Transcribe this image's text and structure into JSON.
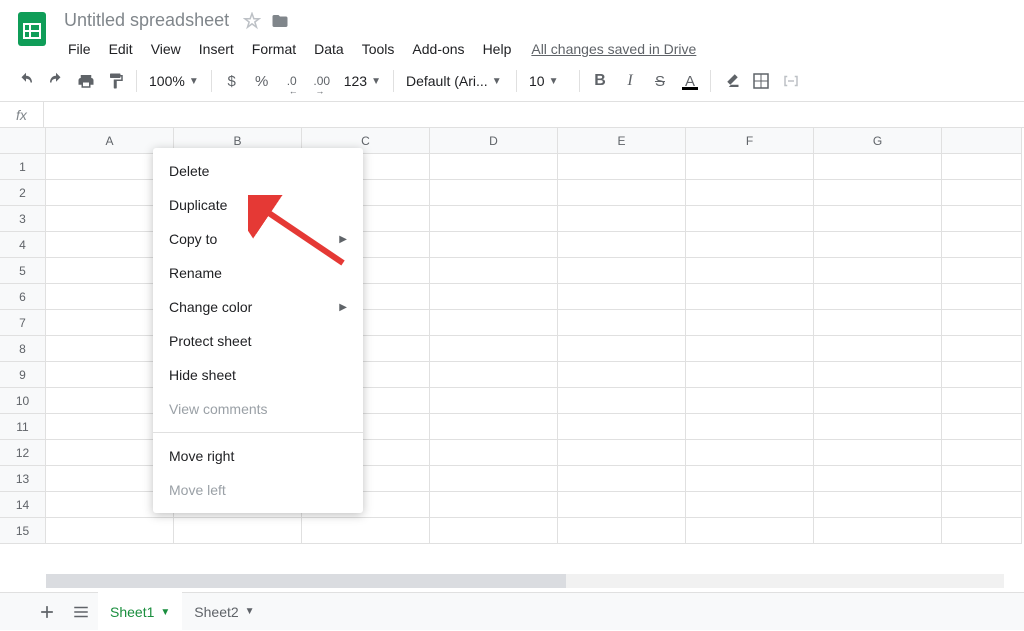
{
  "header": {
    "doc_title": "Untitled spreadsheet"
  },
  "menu": {
    "items": [
      "File",
      "Edit",
      "View",
      "Insert",
      "Format",
      "Data",
      "Tools",
      "Add-ons",
      "Help"
    ],
    "save_status": "All changes saved in Drive"
  },
  "toolbar": {
    "zoom": "100%",
    "currency": "$",
    "percent": "%",
    "dec_dec": ".0",
    "inc_dec": ".00",
    "more_formats": "123",
    "font": "Default (Ari...",
    "font_size": "10"
  },
  "formula": {
    "fx": "fx"
  },
  "columns": [
    "A",
    "B",
    "C",
    "D",
    "E",
    "F",
    "G"
  ],
  "rows": [
    "1",
    "2",
    "3",
    "4",
    "5",
    "6",
    "7",
    "8",
    "9",
    "10",
    "11",
    "12",
    "13",
    "14",
    "15"
  ],
  "context_menu": {
    "items": [
      {
        "label": "Delete",
        "submenu": false,
        "disabled": false
      },
      {
        "label": "Duplicate",
        "submenu": false,
        "disabled": false
      },
      {
        "label": "Copy to",
        "submenu": true,
        "disabled": false
      },
      {
        "label": "Rename",
        "submenu": false,
        "disabled": false
      },
      {
        "label": "Change color",
        "submenu": true,
        "disabled": false
      },
      {
        "label": "Protect sheet",
        "submenu": false,
        "disabled": false
      },
      {
        "label": "Hide sheet",
        "submenu": false,
        "disabled": false
      },
      {
        "label": "View comments",
        "submenu": false,
        "disabled": true
      }
    ],
    "move_items": [
      {
        "label": "Move right",
        "disabled": false
      },
      {
        "label": "Move left",
        "disabled": true
      }
    ]
  },
  "tabs": {
    "sheet1": "Sheet1",
    "sheet2": "Sheet2"
  }
}
